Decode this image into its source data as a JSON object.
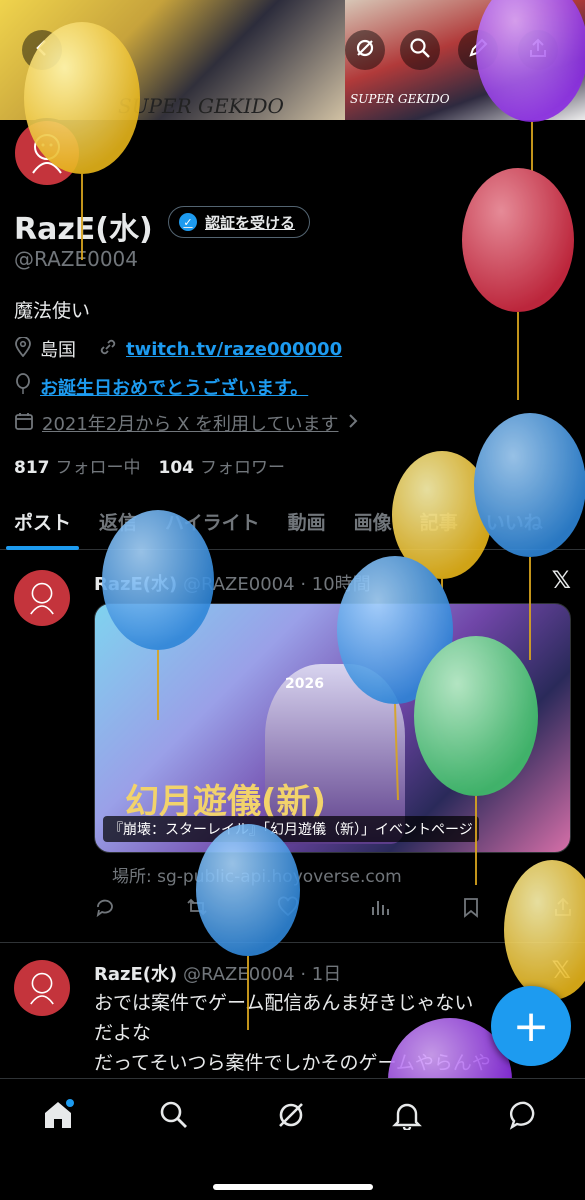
{
  "banner": {
    "left_text": "SUPER GEKIDO",
    "right_text": "SUPER GEKIDO"
  },
  "nav": {
    "back_icon": "back-arrow-icon",
    "grok_icon": "grok-icon",
    "search_icon": "search-icon",
    "edit_icon": "pen-icon",
    "share_icon": "share-icon"
  },
  "profile": {
    "name": "RazE(水)",
    "verify_label": "認証を受ける",
    "handle": "@RAZE0004",
    "bio": "魔法使い",
    "location": "島国",
    "website": "twitch.tv/raze000000",
    "birthday": "お誕生日おめでとうございます。",
    "joined": "2021年2月から X を利用しています",
    "following_count": "817",
    "following_label": "フォロー中",
    "followers_count": "104",
    "followers_label": "フォロワー"
  },
  "tabs": [
    "ポスト",
    "返信",
    "ハイライト",
    "動画",
    "画像",
    "記事",
    "いいね"
  ],
  "posts": [
    {
      "name": "RazE(水)",
      "handle": "@RAZE0004",
      "time": "· 10時間",
      "card_caption": "『崩壊：スターレイル』「幻月遊儀（新）」イベントページ",
      "card_source": "場所: sg-public-api.hoyoverse.com",
      "card_year": "2026"
    },
    {
      "name": "RazE(水)",
      "handle": "@RAZE0004",
      "time": "· 1日",
      "text_line1": "おでは案件でゲーム配信あんま好きじゃない",
      "text_line2": "だよな",
      "text_line3": "だってそいつら案件でしかそのゲームやらんや"
    }
  ],
  "fab_label": "+",
  "colors": {
    "accent": "#1d9bf0",
    "background": "#000000",
    "muted": "#71767b"
  }
}
